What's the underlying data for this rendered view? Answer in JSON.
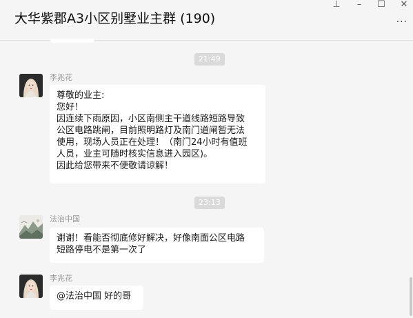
{
  "window": {
    "title": "大华紫郡A3小区别墅业主群 (190)",
    "controls": {
      "pin": "⊥",
      "minimize": "–",
      "maximize": "☐",
      "close": "✕"
    },
    "more": "···"
  },
  "messages": [
    {
      "type": "time",
      "text": "21:49"
    },
    {
      "type": "message",
      "sender": "李兆花",
      "avatar": "woman-avatar",
      "lines": [
        "尊敬的业主:",
        "您好！",
        "因连续下雨原因，小区南侧主干道线路短路导致",
        "公区电路跳闸，目前照明路灯及南门道闸暂无法",
        "使用，现场人员正在处理！（南门24小时有值班",
        "人员，业主可随时核实信息进入园区)。",
        "因此给您带来不便敬请谅解！"
      ]
    },
    {
      "type": "time",
      "text": "23:13"
    },
    {
      "type": "message",
      "sender": "法治中国",
      "avatar": "landscape-avatar",
      "lines": [
        "谢谢！看能否彻底修好解决，好像南面公区电路",
        "短路停电不是第一次了"
      ]
    },
    {
      "type": "message",
      "sender": "李兆花",
      "avatar": "woman-avatar",
      "lines": [
        "@法治中国 好的哥"
      ]
    }
  ]
}
